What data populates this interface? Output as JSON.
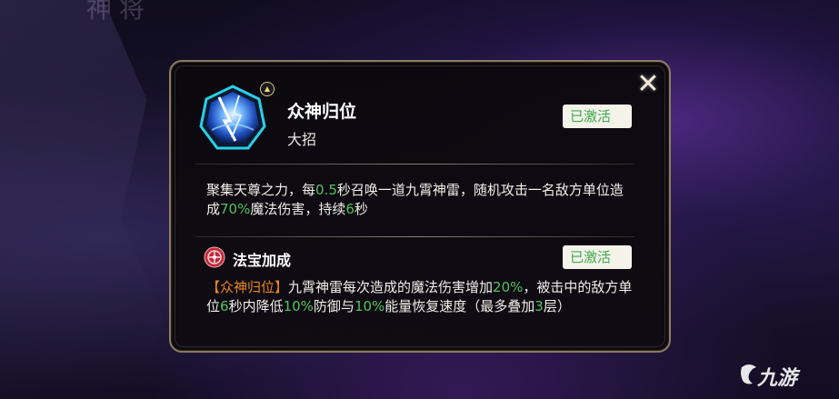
{
  "background": {
    "top_text": "神将"
  },
  "skill": {
    "name": "众神归位",
    "type": "大招",
    "status": "已激活",
    "desc_parts": {
      "p1": "聚集天尊之力，每",
      "v1": "0.5",
      "p2": "秒召唤一道九霄神雷，随机攻击一名敌方单位造成",
      "v2": "70%",
      "p3": "魔法伤害，持续",
      "v3": "6",
      "p4": "秒"
    }
  },
  "treasure": {
    "title": "法宝加成",
    "status": "已激活",
    "desc_parts": {
      "tag": "【众神归位】",
      "p1": "九霄神雷每次造成的魔法伤害增加",
      "v1": "20%",
      "p2": "，被击中的敌方单位",
      "v2": "6",
      "p3": "秒内降低",
      "v3": "10%",
      "p4": "防御与",
      "v4": "10%",
      "p5": "能量恢复速度（最多叠加",
      "v5": "3",
      "p6": "层）"
    }
  },
  "close_label": "✕",
  "upgrade_glyph": "▲",
  "watermark": "九游",
  "icons": {
    "close": "close-icon",
    "skill": "lightning-skill-icon",
    "treasure": "treasure-emblem-icon",
    "upgrade": "upgrade-arrow-icon",
    "watermark": "jiuyou-logo"
  },
  "colors": {
    "highlight_green": "#53c35b",
    "tag_orange": "#e8871f",
    "badge_bg": "#f3f3ea",
    "badge_text": "#3fa94b",
    "panel_border": "#8d7b63"
  }
}
